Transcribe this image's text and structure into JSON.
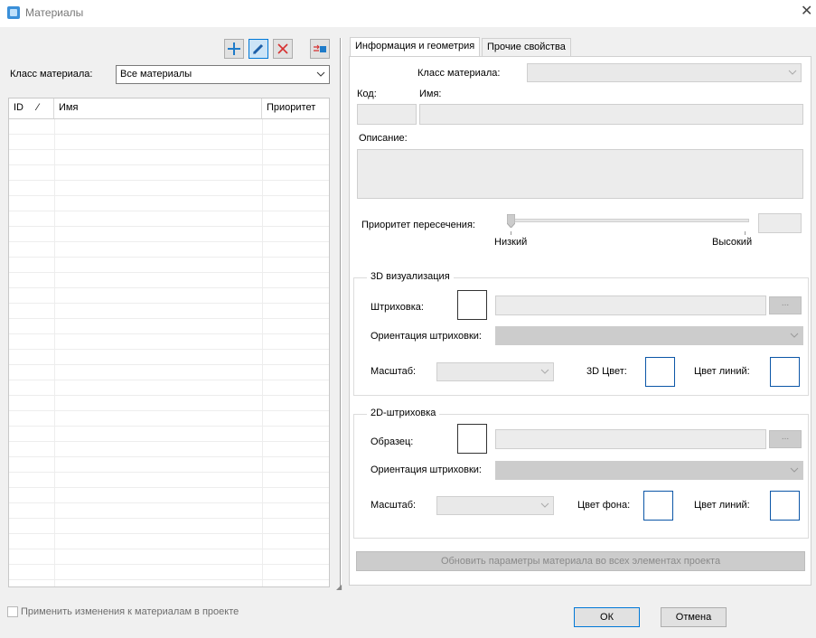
{
  "window": {
    "title": "Материалы",
    "close_glyph": "✕"
  },
  "toolbar": {
    "add_icon": "plus-icon",
    "edit_icon": "pencil-icon",
    "delete_icon": "delete-x-icon",
    "swap_icon": "swap-icon"
  },
  "left": {
    "class_label": "Класс материала:",
    "class_value": "Все материалы",
    "columns": {
      "id": "ID",
      "sort": "⁄",
      "name": "Имя",
      "priority": "Приоритет"
    },
    "rows": []
  },
  "tabs": [
    {
      "label": "Информация и геометрия",
      "active": true
    },
    {
      "label": "Прочие свойства",
      "active": false
    }
  ],
  "info": {
    "class_label": "Класс материала:",
    "class_value": "",
    "code_label": "Код:",
    "code_value": "",
    "name_label": "Имя:",
    "name_value": "",
    "desc_label": "Описание:",
    "desc_value": "",
    "priority_label": "Приоритет пересечения:",
    "priority_low": "Низкий",
    "priority_high": "Высокий",
    "priority_value": "",
    "priority_level": 0
  },
  "viz3d": {
    "title": "3D визуализация",
    "hatch_label": "Штриховка:",
    "hatch_value": "",
    "browse": "...",
    "orient_label": "Ориентация штриховки:",
    "orient_value": "",
    "scale_label": "Масштаб:",
    "scale_value": "",
    "color3d_label": "3D Цвет:",
    "line_color_label": "Цвет линий:"
  },
  "hatch2d": {
    "title": "2D-штриховка",
    "sample_label": "Образец:",
    "sample_value": "",
    "browse": "...",
    "orient_label": "Ориентация штриховки:",
    "orient_value": "",
    "scale_label": "Масштаб:",
    "scale_value": "",
    "bg_color_label": "Цвет фона:",
    "line_color_label": "Цвет линий:"
  },
  "update_button": "Обновить параметры материала во всех элементах проекта",
  "apply_checkbox": {
    "label": "Применить изменения к материалам в проекте",
    "checked": false
  },
  "ok_button": "ОК",
  "cancel_button": "Отмена"
}
